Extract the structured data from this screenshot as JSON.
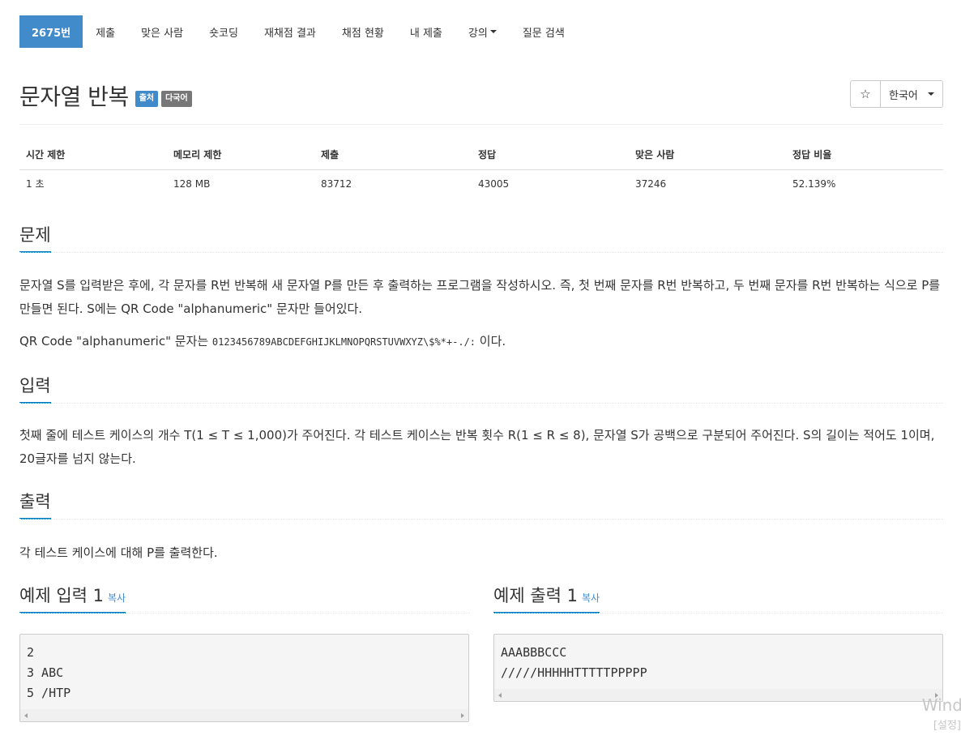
{
  "nav": {
    "items": [
      "2675번",
      "제출",
      "맞은 사람",
      "숏코딩",
      "재채점 결과",
      "채점 현황",
      "내 제출",
      "강의",
      "질문 검색"
    ]
  },
  "problem": {
    "title": "문자열 반복",
    "badge_source": "출처",
    "badge_multilang": "다국어",
    "star": "☆",
    "language": "한국어"
  },
  "stats": {
    "headers": [
      "시간 제한",
      "메모리 제한",
      "제출",
      "정답",
      "맞은 사람",
      "정답 비율"
    ],
    "values": [
      "1 초",
      "128 MB",
      "83712",
      "43005",
      "37246",
      "52.139%"
    ]
  },
  "sections": {
    "problem_title": "문제",
    "problem_p1": "문자열 S를 입력받은 후에, 각 문자를 R번 반복해 새 문자열 P를 만든 후 출력하는 프로그램을 작성하시오. 즉, 첫 번째 문자를 R번 반복하고, 두 번째 문자를 R번 반복하는 식으로 P를 만들면 된다. S에는 QR Code \"alphanumeric\" 문자만 들어있다.",
    "problem_p2_prefix": "QR Code \"alphanumeric\" 문자는 ",
    "problem_p2_code": "0123456789ABCDEFGHIJKLMNOPQRSTUVWXYZ\\$%*+-./:",
    "problem_p2_suffix": " 이다.",
    "input_title": "입력",
    "input_text": "첫째 줄에 테스트 케이스의 개수 T(1 ≤ T ≤ 1,000)가 주어진다. 각 테스트 케이스는 반복 횟수 R(1 ≤ R ≤ 8), 문자열 S가 공백으로 구분되어 주어진다. S의 길이는 적어도 1이며, 20글자를 넘지 않는다.",
    "output_title": "출력",
    "output_text": "각 테스트 케이스에 대해 P를 출력한다.",
    "sample_input_title": "예제 입력 1",
    "sample_output_title": "예제 출력 1",
    "copy_label": "복사"
  },
  "samples": {
    "input": "2\n3 ABC\n5 /HTP",
    "output": "AAABBBCCC\n/////HHHHHTTTTTPPPPP"
  },
  "watermark": {
    "line1": "Wind",
    "line2": "[설정]"
  }
}
